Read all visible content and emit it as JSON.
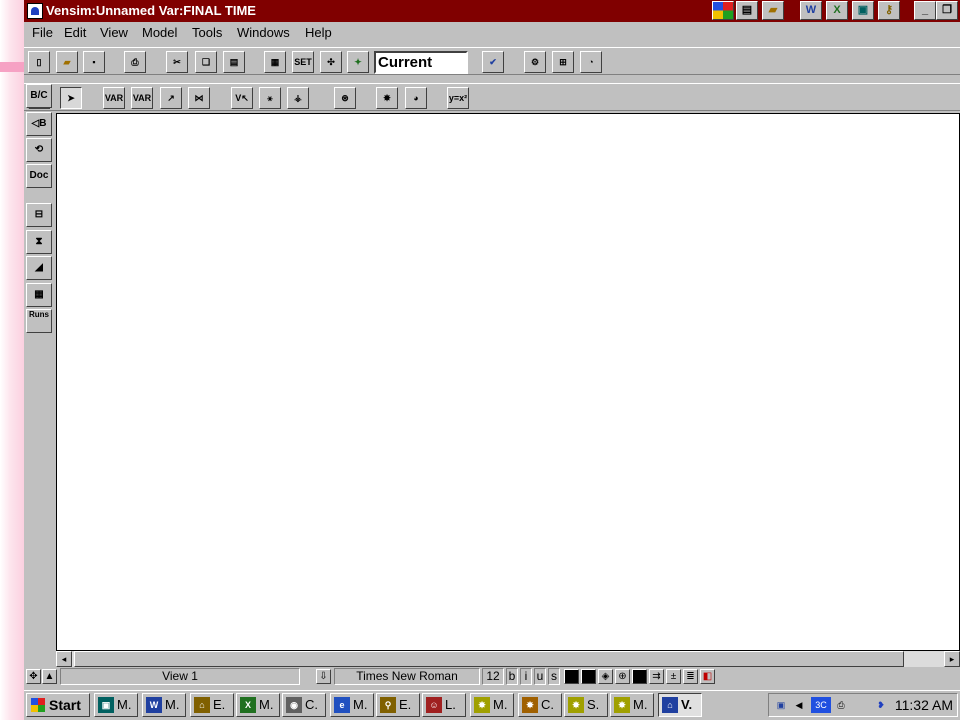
{
  "window": {
    "title": "Vensim:Unnamed Var:FINAL TIME"
  },
  "menu": [
    {
      "label": "File"
    },
    {
      "label": "Edit"
    },
    {
      "label": "View"
    },
    {
      "label": "Model"
    },
    {
      "label": "Tools"
    },
    {
      "label": "Windows"
    },
    {
      "label": "Help"
    }
  ],
  "toolbar_top": {
    "run_name": "Current",
    "buttons": [
      "new-icon",
      "open-icon",
      "save-icon",
      "print-icon",
      "cut-icon",
      "copy-icon",
      "paste-icon",
      "control-panel-icon",
      "set-icon",
      "synthesim-icon",
      "run-icon",
      "check-icon",
      "reality-check-icon",
      "model-check-icon",
      "units-check-icon"
    ]
  },
  "toolbar_sketch": {
    "labels": {
      "var": "VAR",
      "var2": "VAR"
    }
  },
  "sidebar": {
    "doc_label": "Doc",
    "runs_label": "Runs"
  },
  "status": {
    "view": "View 1",
    "font": "Times New Roman",
    "size": "12",
    "bold": "b",
    "italic": "i",
    "underline": "u",
    "strike": "s"
  },
  "taskbar": {
    "start_label": "Start",
    "tasks": [
      {
        "label": "M.",
        "icon": "monitor-icon",
        "color": "#006060"
      },
      {
        "label": "M.",
        "icon": "word-icon",
        "color": "#2040a0"
      },
      {
        "label": "E.",
        "icon": "explorer-icon",
        "color": "#806000"
      },
      {
        "label": "M.",
        "icon": "excel-icon",
        "color": "#207020"
      },
      {
        "label": "C.",
        "icon": "cd-icon",
        "color": "#606060"
      },
      {
        "label": "M.",
        "icon": "ie-icon",
        "color": "#2050c0"
      },
      {
        "label": "E.",
        "icon": "find-icon",
        "color": "#806000"
      },
      {
        "label": "L.",
        "icon": "people-icon",
        "color": "#a02020"
      },
      {
        "label": "M.",
        "icon": "vensim-icon",
        "color": "#a0a000"
      },
      {
        "label": "C.",
        "icon": "vensim-icon",
        "color": "#a06000"
      },
      {
        "label": "S.",
        "icon": "vensim-icon",
        "color": "#a0a000"
      },
      {
        "label": "M.",
        "icon": "vensim-icon",
        "color": "#a0a000"
      },
      {
        "label": "V.",
        "icon": "vensim-icon",
        "color": "#2040a0",
        "active": true
      }
    ],
    "clock": "11:32 AM"
  }
}
